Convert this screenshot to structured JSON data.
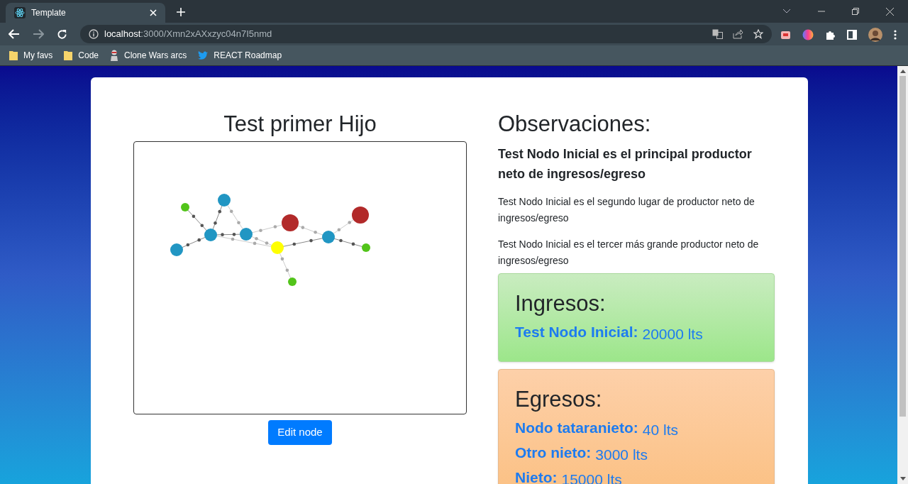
{
  "browser": {
    "tab": {
      "title": "Template",
      "selected": true
    },
    "address": {
      "host": "localhost",
      "path": ":3000/Xmn2xAXxzyc04n7I5nmd"
    },
    "bookmarks": [
      {
        "kind": "folder",
        "label": "My favs"
      },
      {
        "kind": "folder",
        "label": "Code"
      },
      {
        "kind": "figure",
        "label": "Clone Wars arcs"
      },
      {
        "kind": "bird",
        "label": "REACT Roadmap"
      }
    ]
  },
  "graph_panel": {
    "title": "Test primer Hijo",
    "button": "Edit node"
  },
  "observations": {
    "title": "Observaciones:",
    "lead": "Test Nodo Inicial es el principal productor neto de ingresos/egreso",
    "paragraphs": [
      "Test Nodo Inicial es el segundo lugar de productor neto de ingresos/egreso",
      "Test Nodo Inicial es el tercer más grande productor neto de ingresos/egreso"
    ]
  },
  "cards": [
    {
      "kind": "income",
      "title": "Ingresos:",
      "entries": [
        {
          "name": "Test Nodo Inicial:",
          "amount": "20000 lts"
        }
      ]
    },
    {
      "kind": "expense",
      "title": "Egresos:",
      "entries": [
        {
          "name": "Nodo tataranieto:",
          "amount": "40 lts"
        },
        {
          "name": "Otro nieto:",
          "amount": "3000 lts"
        },
        {
          "name": "Nieto:",
          "amount": "15000 lts"
        }
      ]
    }
  ]
}
